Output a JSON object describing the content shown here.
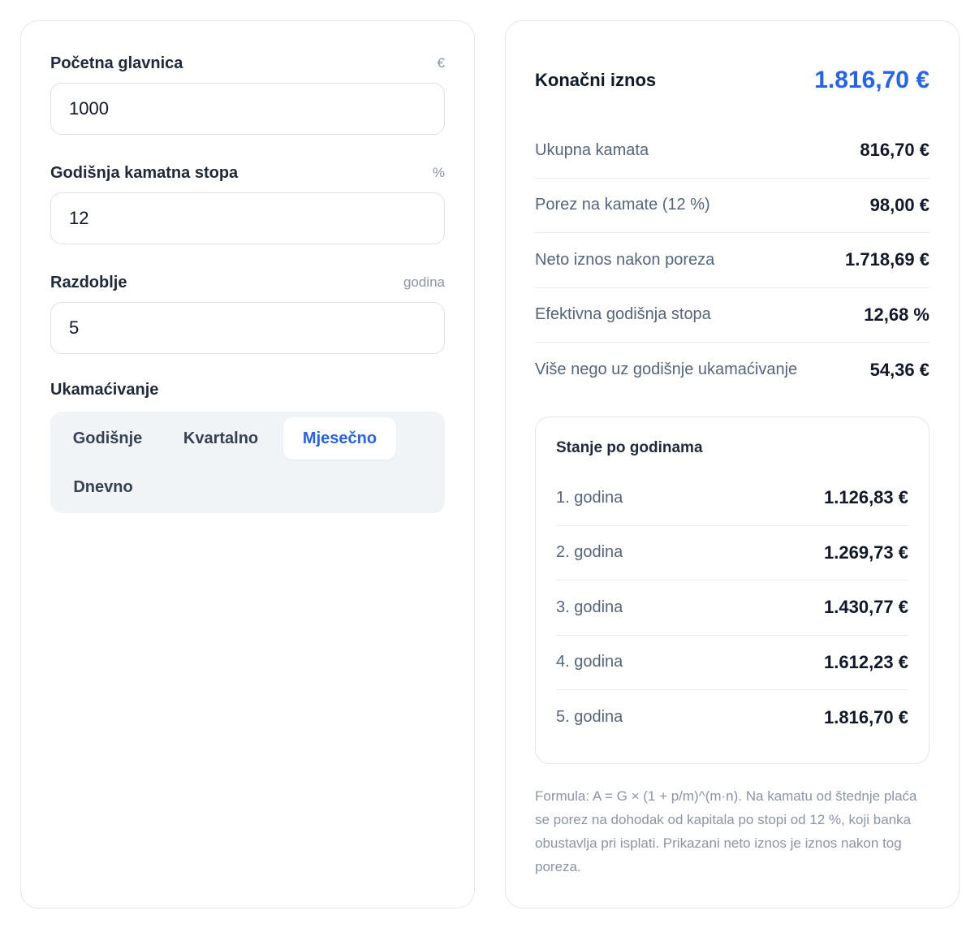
{
  "form": {
    "principal": {
      "label": "Početna glavnica",
      "unit": "€",
      "value": "1000"
    },
    "rate": {
      "label": "Godišnja kamatna stopa",
      "unit": "%",
      "value": "12"
    },
    "period": {
      "label": "Razdoblje",
      "unit": "godina",
      "value": "5"
    },
    "compounding": {
      "label": "Ukamaćivanje",
      "options": [
        "Godišnje",
        "Kvartalno",
        "Mjesečno",
        "Dnevno"
      ],
      "selected": "Mjesečno"
    }
  },
  "results": {
    "total_label": "Konačni iznos",
    "total_value": "1.816,70 €",
    "metrics": [
      {
        "label": "Ukupna kamata",
        "value": "816,70 €"
      },
      {
        "label": "Porez na kamate (12 %)",
        "value": "98,00 €"
      },
      {
        "label": "Neto iznos nakon poreza",
        "value": "1.718,69 €"
      },
      {
        "label": "Efektivna godišnja stopa",
        "value": "12,68 %"
      },
      {
        "label": "Više nego uz godišnje ukamaćivanje",
        "value": "54,36 €"
      }
    ],
    "yearly": {
      "title": "Stanje po godinama",
      "rows": [
        {
          "year": "1. godina",
          "value": "1.126,83 €"
        },
        {
          "year": "2. godina",
          "value": "1.269,73 €"
        },
        {
          "year": "3. godina",
          "value": "1.430,77 €"
        },
        {
          "year": "4. godina",
          "value": "1.612,23 €"
        },
        {
          "year": "5. godina",
          "value": "1.816,70 €"
        }
      ]
    },
    "note": "Formula: A = G × (1 + p/m)^(m·n). Na kamatu od štednje plaća se porez na dohodak od kapitala po stopi od 12 %, koji banka obustavlja pri isplati. Prikazani neto iznos je iznos nakon tog poreza."
  },
  "colors": {
    "accent": "#2563eb",
    "border": "#e3e7ec",
    "muted": "#8b95a3",
    "segment_bg": "#f1f4f7"
  }
}
